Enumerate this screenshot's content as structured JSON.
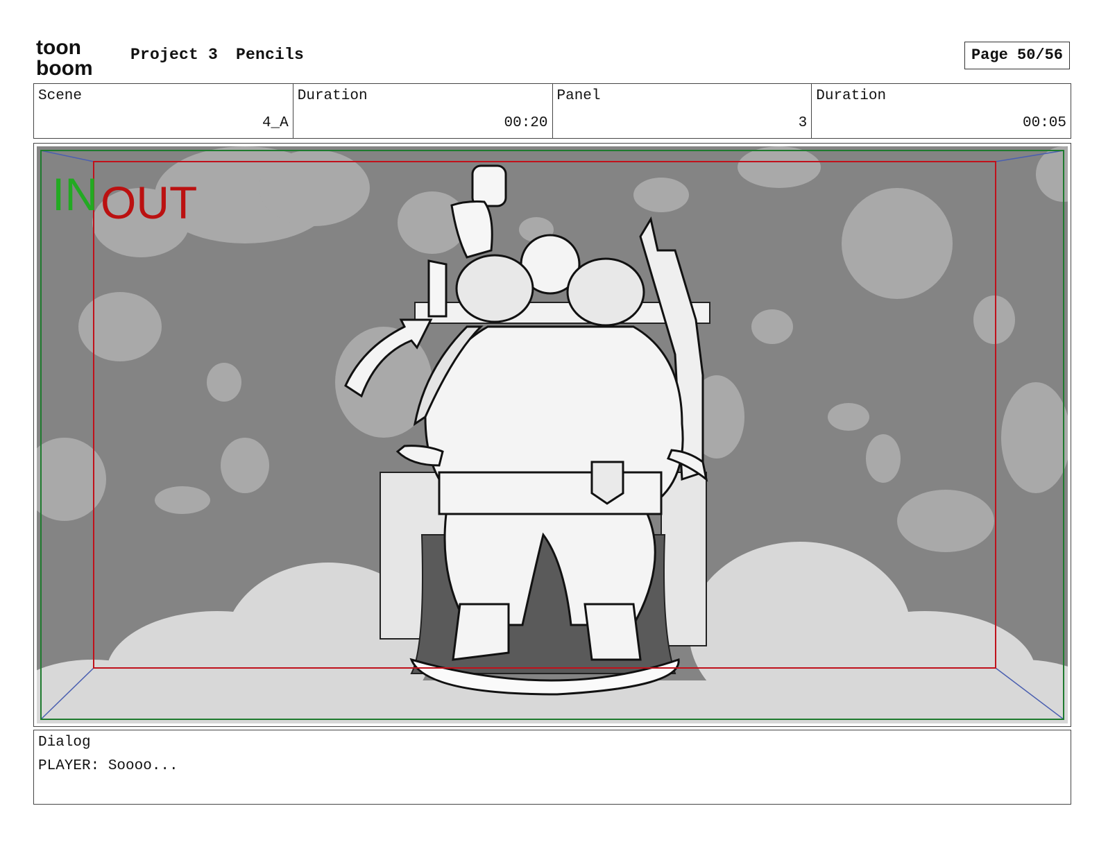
{
  "header": {
    "logo_text_top": "toon",
    "logo_text_bottom": "boom",
    "project": "Project 3",
    "stage": "Pencils",
    "page": "Page 50/56"
  },
  "info": {
    "scene_label": "Scene",
    "scene_value": "4_A",
    "scene_duration_label": "Duration",
    "scene_duration_value": "00:20",
    "panel_label": "Panel",
    "panel_value": "3",
    "panel_duration_label": "Duration",
    "panel_duration_value": "00:05"
  },
  "panel": {
    "in_text": "IN",
    "out_text": "OUT",
    "colors": {
      "background": "#848484",
      "cloud": "#a9a9a9",
      "ground": "#d8d8d8",
      "safe_frame": "#c0111b",
      "outer_frame": "#1e7a2e",
      "in": "#22aa22",
      "out": "#bb1111"
    }
  },
  "dialog": {
    "label": "Dialog",
    "text": "PLAYER: Soooo..."
  }
}
